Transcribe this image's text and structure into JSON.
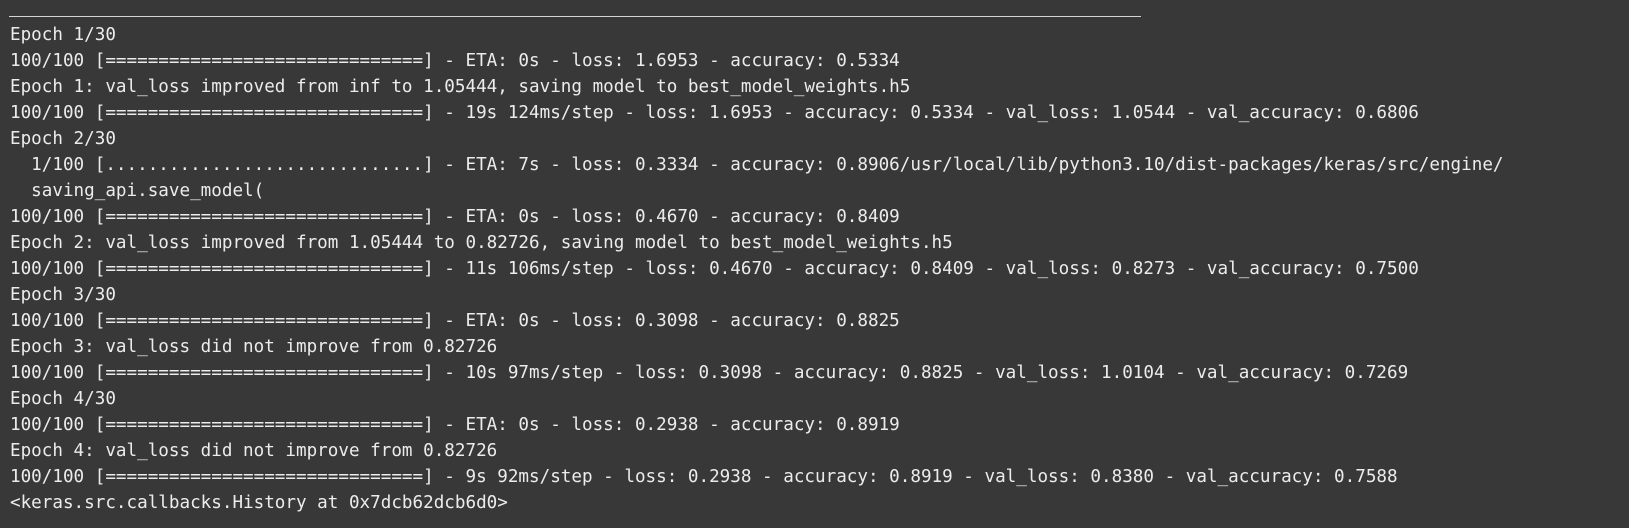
{
  "output": {
    "lines": [
      "Epoch 1/30",
      "100/100 [==============================] - ETA: 0s - loss: 1.6953 - accuracy: 0.5334",
      "Epoch 1: val_loss improved from inf to 1.05444, saving model to best_model_weights.h5",
      "100/100 [==============================] - 19s 124ms/step - loss: 1.6953 - accuracy: 0.5334 - val_loss: 1.0544 - val_accuracy: 0.6806",
      "Epoch 2/30",
      "  1/100 [..............................] - ETA: 7s - loss: 0.3334 - accuracy: 0.8906/usr/local/lib/python3.10/dist-packages/keras/src/engine/",
      "  saving_api.save_model(",
      "100/100 [==============================] - ETA: 0s - loss: 0.4670 - accuracy: 0.8409",
      "Epoch 2: val_loss improved from 1.05444 to 0.82726, saving model to best_model_weights.h5",
      "100/100 [==============================] - 11s 106ms/step - loss: 0.4670 - accuracy: 0.8409 - val_loss: 0.8273 - val_accuracy: 0.7500",
      "Epoch 3/30",
      "100/100 [==============================] - ETA: 0s - loss: 0.3098 - accuracy: 0.8825",
      "Epoch 3: val_loss did not improve from 0.82726",
      "100/100 [==============================] - 10s 97ms/step - loss: 0.3098 - accuracy: 0.8825 - val_loss: 1.0104 - val_accuracy: 0.7269",
      "Epoch 4/30",
      "100/100 [==============================] - ETA: 0s - loss: 0.2938 - accuracy: 0.8919",
      "Epoch 4: val_loss did not improve from 0.82726",
      "100/100 [==============================] - 9s 92ms/step - loss: 0.2938 - accuracy: 0.8919 - val_loss: 0.8380 - val_accuracy: 0.7588",
      "<keras.src.callbacks.History at 0x7dcb62dcb6d0>"
    ]
  }
}
